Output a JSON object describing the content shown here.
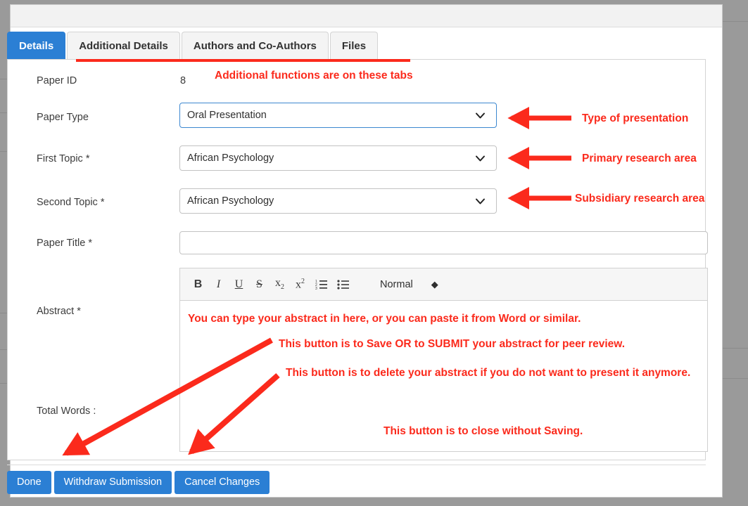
{
  "window": {
    "title": ""
  },
  "tabs": [
    {
      "label": "Details",
      "active": true
    },
    {
      "label": "Additional Details",
      "active": false
    },
    {
      "label": "Authors and Co-Authors",
      "active": false
    },
    {
      "label": "Files",
      "active": false
    }
  ],
  "form": {
    "paper_id": {
      "label": "Paper ID",
      "value": "8"
    },
    "paper_type": {
      "label": "Paper Type",
      "value": "Oral Presentation",
      "focused": true
    },
    "first_topic": {
      "label": "First Topic *",
      "value": "African Psychology",
      "focused": false
    },
    "second_topic": {
      "label": "Second Topic *",
      "value": "African Psychology",
      "focused": false
    },
    "paper_title": {
      "label": "Paper Title *",
      "value": "",
      "placeholder": ""
    },
    "abstract": {
      "label": "Abstract *"
    },
    "total_words": {
      "label": "Total Words :",
      "value": ""
    }
  },
  "editor": {
    "toolbar": {
      "bold": "B",
      "italic": "I",
      "underline": "U",
      "strike": "S",
      "subscript_base": "x",
      "subscript_mark": "2",
      "superscript_base": "x",
      "superscript_mark": "2",
      "ordered_list_icon": "ordered-list-icon",
      "bullet_list_icon": "bullet-list-icon",
      "format": "Normal",
      "stepper_icon": "up-down-stepper-icon"
    },
    "content": ""
  },
  "footer_buttons": [
    {
      "label": "Done"
    },
    {
      "label": "Withdraw Submission"
    },
    {
      "label": "Cancel Changes"
    }
  ],
  "annotations": {
    "tabs_note": "Additional functions are on these tabs",
    "paper_type_note": "Type of presentation",
    "first_topic_note": "Primary research area",
    "second_topic_note": "Subsidiary research area",
    "abstract_note": "You can type your abstract in here, or you can paste it from Word or similar.",
    "done_note": "This button is to Save OR to SUBMIT your abstract for peer review.",
    "withdraw_note": "This button is to delete your abstract if you do not want to present it anymore.",
    "cancel_note": "This button is to close without Saving."
  },
  "colors": {
    "accent_blue": "#2b7fd4",
    "annotation_red": "#fb2a1c",
    "backdrop_gray": "#9a9a9a",
    "focus_border": "#3c87d0"
  }
}
